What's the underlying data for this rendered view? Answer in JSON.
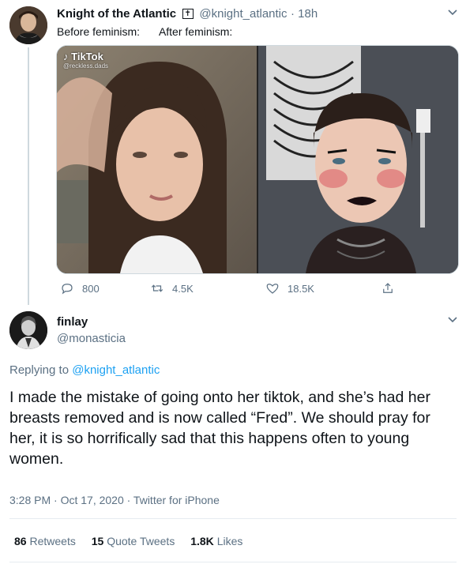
{
  "tweet1": {
    "name": "Knight of the Atlantic",
    "badge": "✝",
    "handle": "@knight_atlantic",
    "time": "18h",
    "text_before": "Before feminism:",
    "text_after": "After feminism:",
    "media": {
      "watermark_brand": "TikTok",
      "watermark_user": "@reckless.dads"
    },
    "actions": {
      "replies": "800",
      "retweets": "4.5K",
      "likes": "18.5K"
    }
  },
  "tweet2": {
    "name": "finlay",
    "handle": "@monasticia",
    "replying_prefix": "Replying to ",
    "replying_to": "@knight_atlantic",
    "text": "I made the mistake of going onto her tiktok, and she’s had her breasts removed and is now called “Fred”. We should pray for her, it is so horrifically sad that this happens often to young women.",
    "timestamp": "3:28 PM · Oct 17, 2020 · Twitter for iPhone",
    "stats": {
      "retweets_count": "86",
      "retweets_label": "Retweets",
      "quotes_count": "15",
      "quotes_label": "Quote Tweets",
      "likes_count": "1.8K",
      "likes_label": "Likes"
    }
  },
  "colors": {
    "link": "#1da1f2",
    "muted": "#5b7083",
    "text": "#0f1419"
  }
}
